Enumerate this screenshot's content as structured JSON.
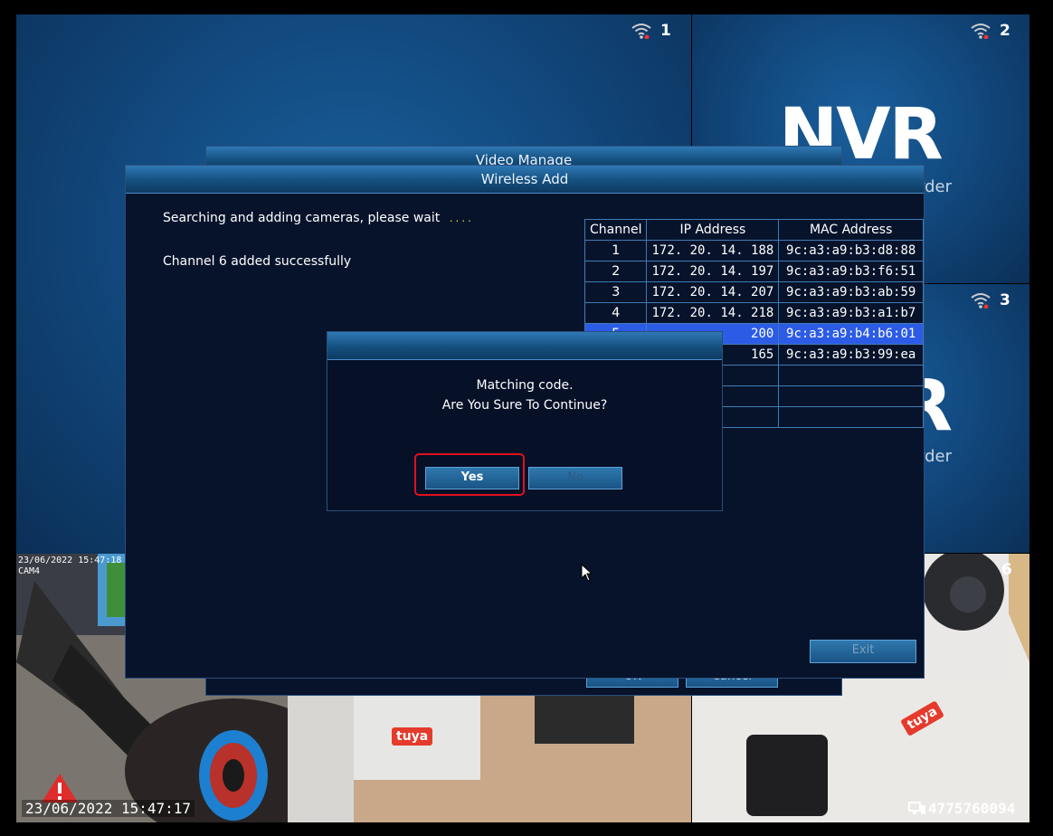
{
  "grid": {
    "channels": [
      {
        "number": "1"
      },
      {
        "number": "2",
        "logo": "NVR",
        "subtitle": "rder"
      },
      {
        "number": "3",
        "logo": "R",
        "subtitle": "rder"
      },
      {
        "number": "6"
      }
    ],
    "cam4_osd": {
      "date": "23/06/2022 15:47:18",
      "name": "CAM4"
    },
    "bottom_osd": {
      "datetime": "23/06/2022 15:47:17",
      "device_id": "4775760094"
    },
    "tuya_label": "tuya"
  },
  "video_manage": {
    "title": "Video Manage",
    "ok_label": "OK",
    "cancel_label": "Cancel"
  },
  "wireless_add": {
    "title": "Wireless Add",
    "status_text": "Searching and adding cameras, please wait",
    "status_dots": "....",
    "result_text": "Channel 6 added successfully",
    "exit_label": "Exit",
    "table": {
      "headers": [
        "Channel",
        "IP Address",
        "MAC Address"
      ],
      "rows": [
        {
          "channel": "1",
          "ip": "172. 20. 14. 188",
          "mac": "9c:a3:a9:b3:d8:88"
        },
        {
          "channel": "2",
          "ip": "172. 20. 14. 197",
          "mac": "9c:a3:a9:b3:f6:51"
        },
        {
          "channel": "3",
          "ip": "172. 20. 14. 207",
          "mac": "9c:a3:a9:b3:ab:59"
        },
        {
          "channel": "4",
          "ip": "172. 20. 14. 218",
          "mac": "9c:a3:a9:b3:a1:b7"
        },
        {
          "channel": "5",
          "ip": "200",
          "mac": "9c:a3:a9:b4:b6:01"
        },
        {
          "channel": "",
          "ip": "165",
          "mac": "9c:a3:a9:b3:99:ea"
        },
        {
          "channel": "",
          "ip": "",
          "mac": ""
        },
        {
          "channel": "",
          "ip": "",
          "mac": ""
        },
        {
          "channel": "",
          "ip": "",
          "mac": ""
        }
      ]
    }
  },
  "confirm_dialog": {
    "line1": "Matching code.",
    "line2": "Are You Sure To Continue?",
    "yes_label": "Yes",
    "no_label": "No"
  },
  "colors": {
    "highlight_border": "#e0101e",
    "selected_row": "#2c5be6",
    "status_dots": "#d8d23a"
  }
}
